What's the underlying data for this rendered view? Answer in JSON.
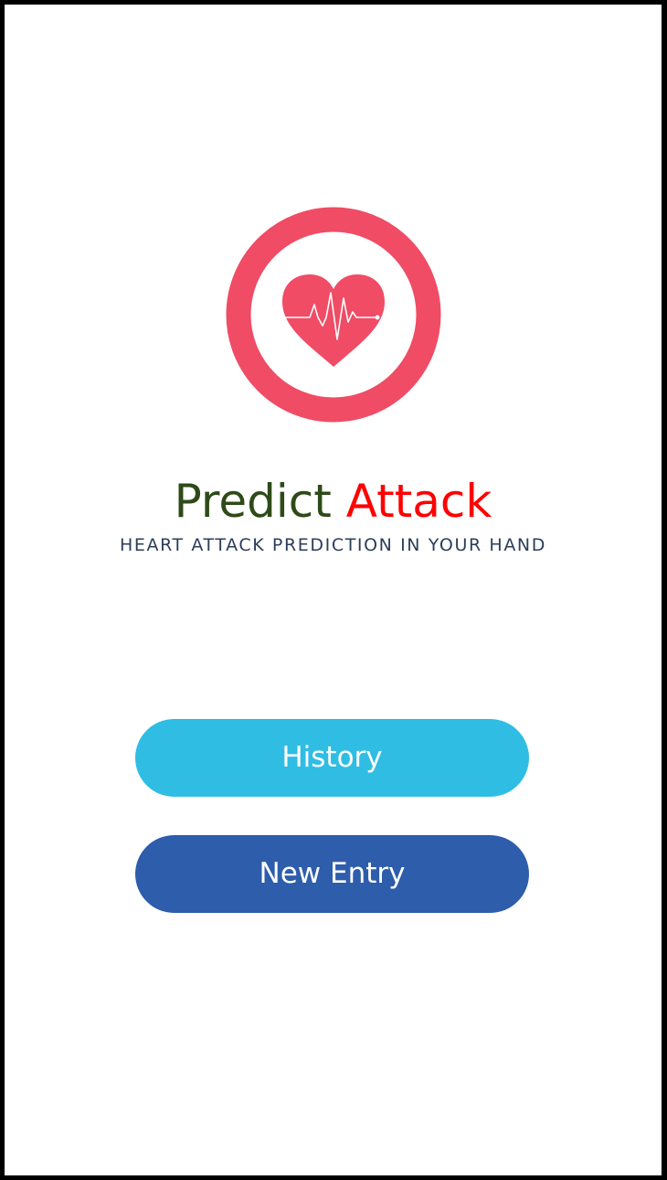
{
  "app": {
    "title_part1": "Predict",
    "title_part2": "Attack",
    "tagline": "HEART ATTACK PREDICTION IN YOUR HAND"
  },
  "logo": {
    "icon": "heart-pulse-icon",
    "ring_color": "#f04c65",
    "heart_color": "#f04c65"
  },
  "buttons": {
    "history_label": "History",
    "new_entry_label": "New Entry"
  },
  "colors": {
    "title_part1": "#2e4a18",
    "title_part2": "#ff0000",
    "tagline": "#2c3e5a",
    "history_button": "#2fbde4",
    "new_entry_button": "#2d5dab",
    "background": "#ffffff"
  }
}
